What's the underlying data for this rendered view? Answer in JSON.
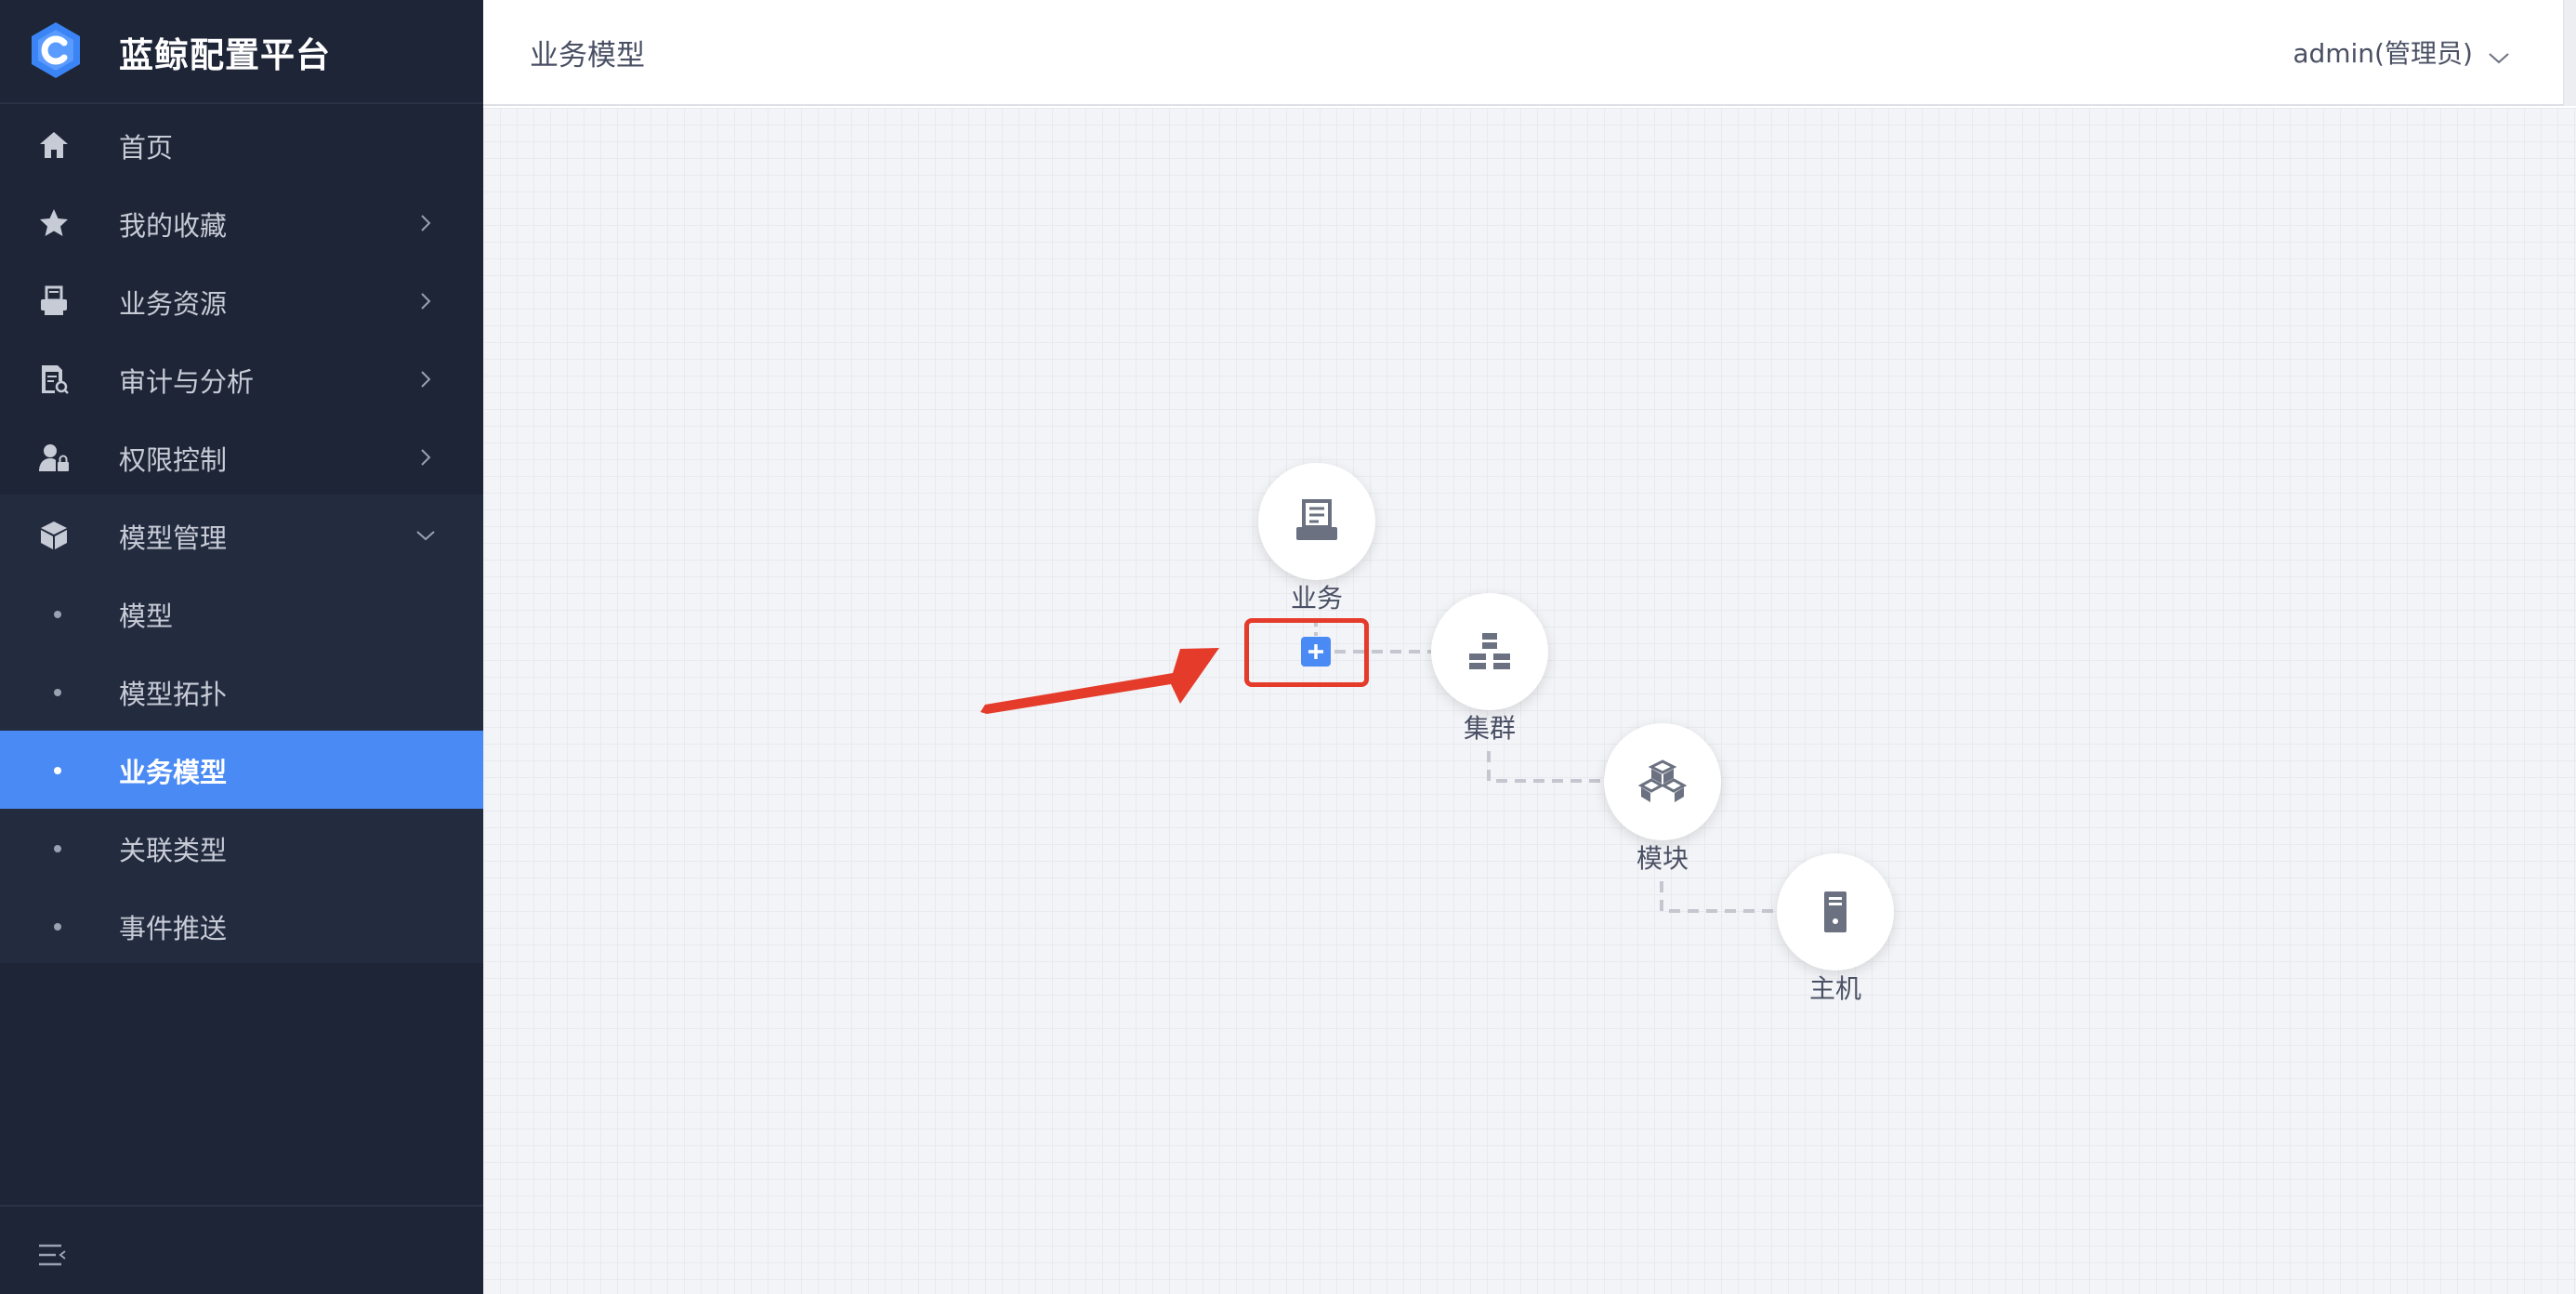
{
  "brand": {
    "title": "蓝鲸配置平台"
  },
  "nav": {
    "items": [
      {
        "label": "首页",
        "icon": "home-icon"
      },
      {
        "label": "我的收藏",
        "icon": "star-icon"
      },
      {
        "label": "业务资源",
        "icon": "printer-icon"
      },
      {
        "label": "审计与分析",
        "icon": "document-search-icon"
      },
      {
        "label": "权限控制",
        "icon": "user-lock-icon"
      },
      {
        "label": "模型管理",
        "icon": "cube-icon",
        "expanded": true
      }
    ],
    "submenu": [
      {
        "label": "模型"
      },
      {
        "label": "模型拓扑"
      },
      {
        "label": "业务模型",
        "active": true
      },
      {
        "label": "关联类型"
      },
      {
        "label": "事件推送"
      }
    ]
  },
  "header": {
    "title": "业务模型",
    "user": "admin(管理员)"
  },
  "topology": {
    "nodes": [
      {
        "label": "业务",
        "icon": "business-icon"
      },
      {
        "label": "集群",
        "icon": "cluster-icon"
      },
      {
        "label": "模块",
        "icon": "module-icon"
      },
      {
        "label": "主机",
        "icon": "host-icon"
      }
    ],
    "add_button_label": "+"
  },
  "colors": {
    "sidebar_bg": "#1e2536",
    "active": "#4a8af4",
    "annotation": "#e43b2b"
  }
}
